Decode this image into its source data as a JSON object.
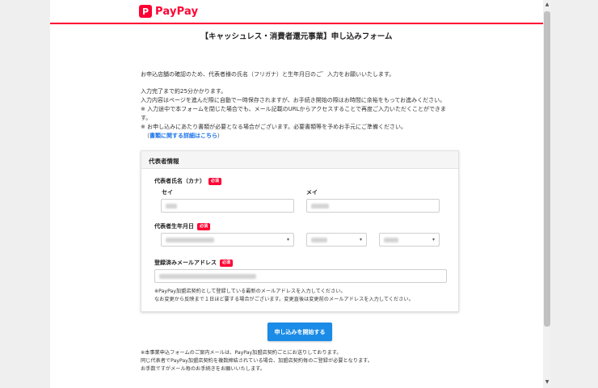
{
  "header": {
    "logo_mark": "P",
    "logo_text": "PayPay",
    "brand_color": "#ff0033"
  },
  "page_title": "【キャッシュレス・消費者還元事業】申し込みフォーム",
  "intro": {
    "main": "お申込店舗の確認のため、代表者様の氏名（フリガナ）と生年月日のご゛入力をお願いいたします。",
    "notes": [
      "入力完了まで約25分かかります。",
      "入力内容はページを進んだ際に自動で一時保存されますが、お手続き開始の際はお時間に余裕をもってお進みください。",
      "※ 入力途中で本フォームを閉じた場合でも、メール記載のURLからアクセスすることで再度ご入力いただくことができます。",
      "※ お申し込みにあたり書類が必要となる場合がございます。必要書類等を予めお手元にご準備ください。"
    ],
    "link_prefix": "（",
    "link_text": "書類に関する詳細はこちら",
    "link_suffix": "）"
  },
  "form": {
    "section_title": "代表者情報",
    "required_badge": "必須",
    "name_kana_label": "代表者氏名（カナ）",
    "sei_label": "セイ",
    "mei_label": "メイ",
    "birthdate_label": "代表者生年月日",
    "email_label": "登録済みメールアドレス",
    "email_hint_1": "※PayPay加盟店契約として登録している最新のメールアドレスを入力してください。",
    "email_hint_2": "なお変更から反映まで１日ほど要する場合がございます。変更直後は変更前のメールアドレスを入力してください。"
  },
  "submit_label": "申し込みを開始する",
  "footer": [
    "※本事業申込フォームのご案内メールは、PayPay加盟店契約ごとにお送りしております。",
    "同じ代表者でPayPay加盟店契約を複数締結されている場合、加盟店契約毎のご登録が必要となります。",
    "お手数ですがメール毎のお手続きをお願いいたします。"
  ],
  "icons": {
    "caret": "▾",
    "scroll_up": "▲",
    "scroll_down": "▼"
  }
}
